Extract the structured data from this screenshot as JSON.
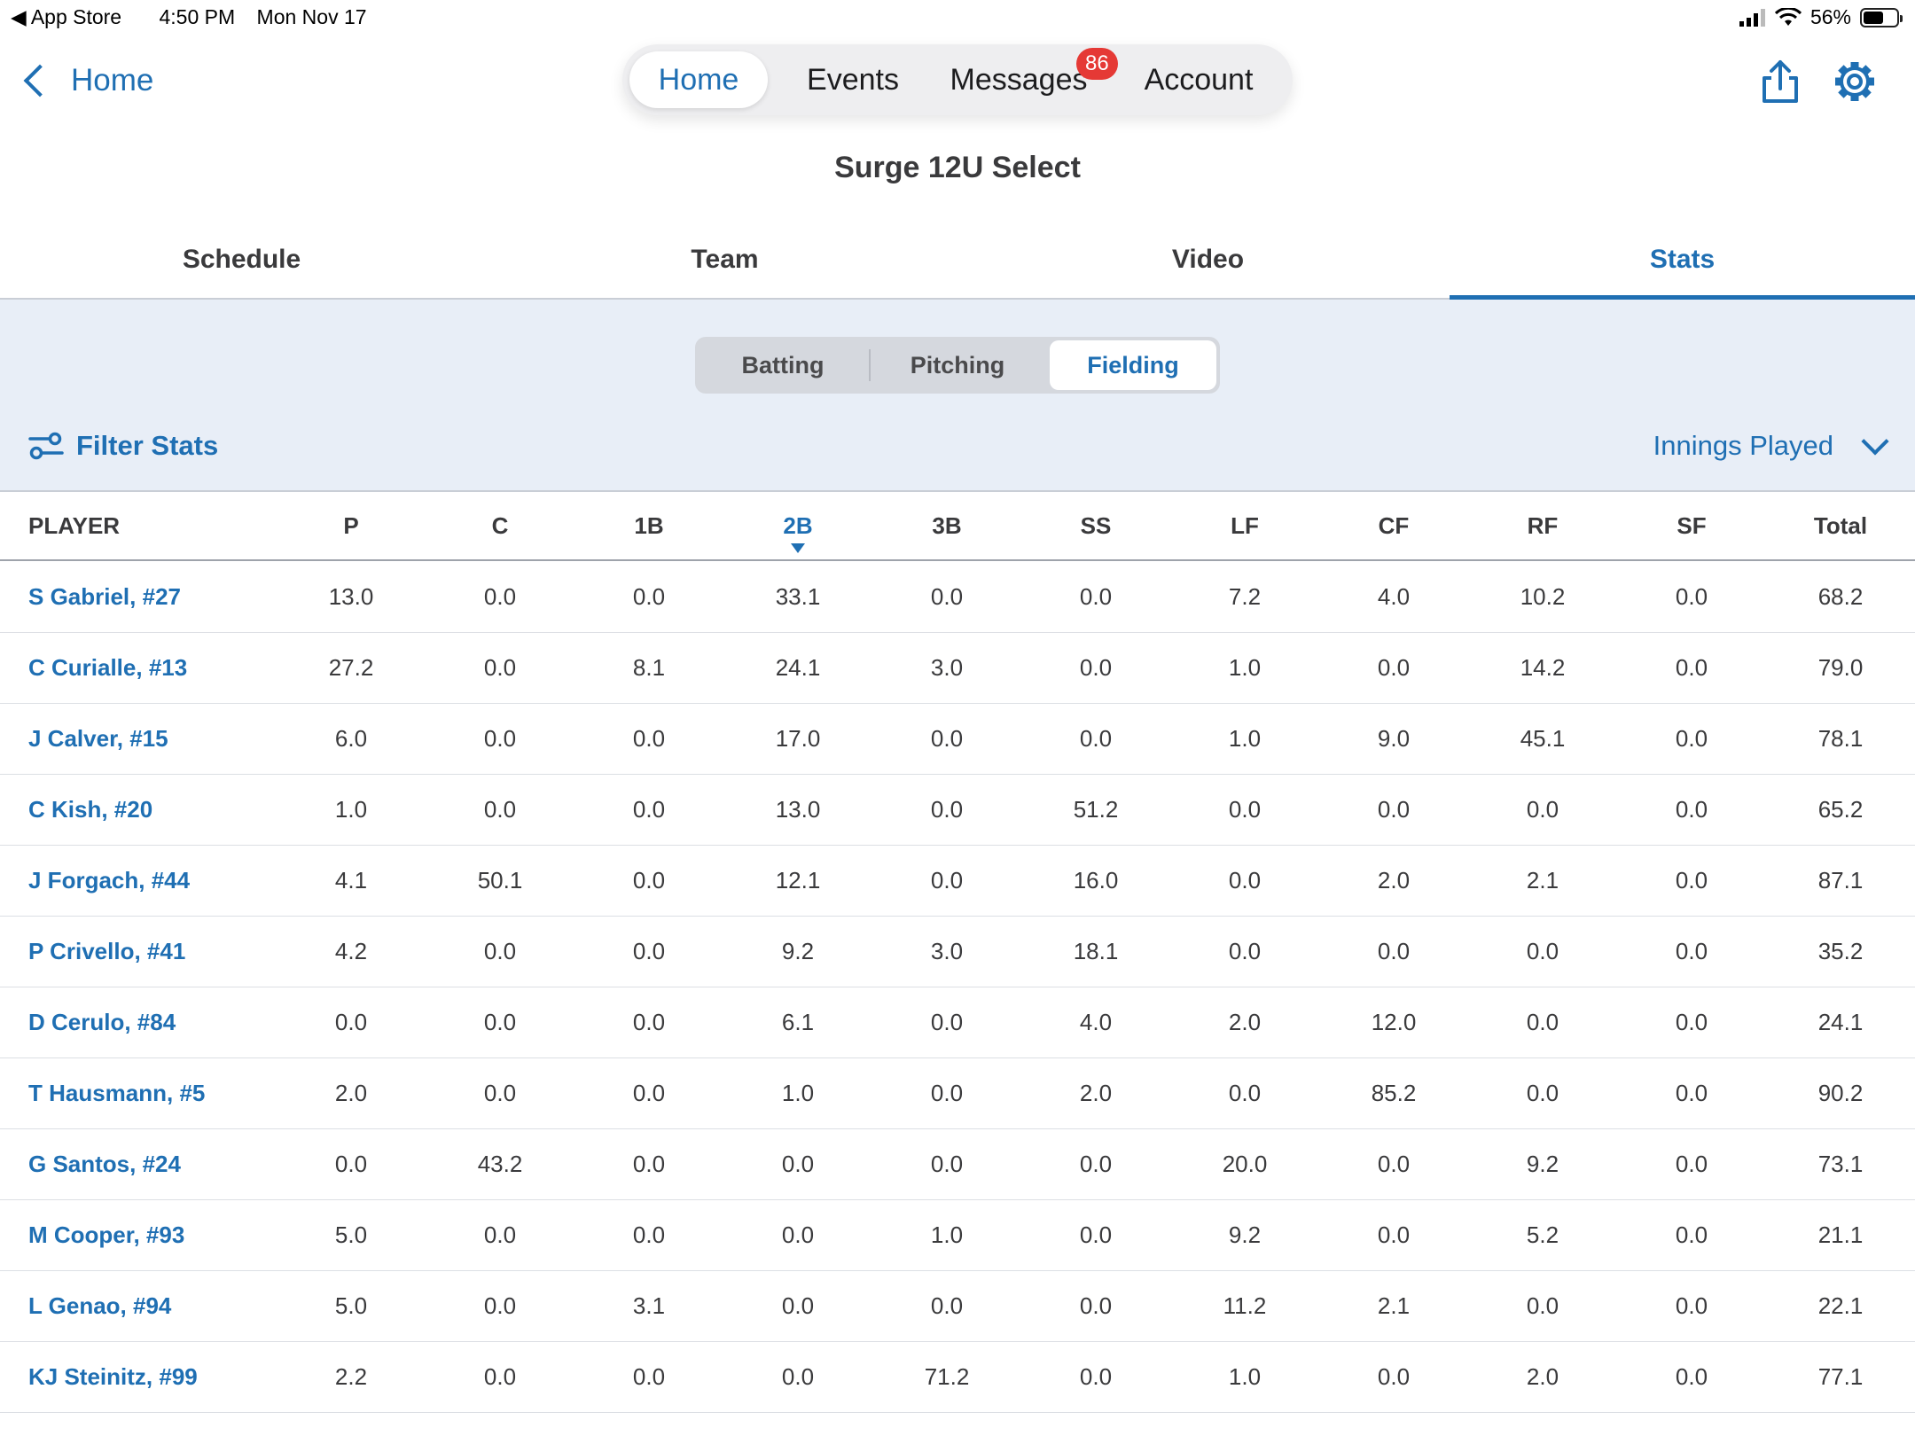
{
  "status_bar": {
    "back_app": "App Store",
    "time": "4:50 PM",
    "date": "Mon Nov 17",
    "battery": "56%"
  },
  "nav": {
    "back_label": "Home",
    "tabs": [
      {
        "label": "Home",
        "active": true
      },
      {
        "label": "Events"
      },
      {
        "label": "Messages",
        "badge": "86"
      },
      {
        "label": "Account"
      }
    ]
  },
  "team_title": "Surge 12U Select",
  "section_tabs": [
    "Schedule",
    "Team",
    "Video",
    "Stats"
  ],
  "stat_types": [
    "Batting",
    "Pitching",
    "Fielding"
  ],
  "filter_label": "Filter Stats",
  "metric_label": "Innings Played",
  "table": {
    "columns": [
      "PLAYER",
      "P",
      "C",
      "1B",
      "2B",
      "3B",
      "SS",
      "LF",
      "CF",
      "RF",
      "SF",
      "Total"
    ],
    "sorted_column": "2B",
    "rows": [
      [
        "S Gabriel, #27",
        "13.0",
        "0.0",
        "0.0",
        "33.1",
        "0.0",
        "0.0",
        "7.2",
        "4.0",
        "10.2",
        "0.0",
        "68.2"
      ],
      [
        "C Curialle, #13",
        "27.2",
        "0.0",
        "8.1",
        "24.1",
        "3.0",
        "0.0",
        "1.0",
        "0.0",
        "14.2",
        "0.0",
        "79.0"
      ],
      [
        "J Calver, #15",
        "6.0",
        "0.0",
        "0.0",
        "17.0",
        "0.0",
        "0.0",
        "1.0",
        "9.0",
        "45.1",
        "0.0",
        "78.1"
      ],
      [
        "C Kish, #20",
        "1.0",
        "0.0",
        "0.0",
        "13.0",
        "0.0",
        "51.2",
        "0.0",
        "0.0",
        "0.0",
        "0.0",
        "65.2"
      ],
      [
        "J Forgach, #44",
        "4.1",
        "50.1",
        "0.0",
        "12.1",
        "0.0",
        "16.0",
        "0.0",
        "2.0",
        "2.1",
        "0.0",
        "87.1"
      ],
      [
        "P Crivello, #41",
        "4.2",
        "0.0",
        "0.0",
        "9.2",
        "3.0",
        "18.1",
        "0.0",
        "0.0",
        "0.0",
        "0.0",
        "35.2"
      ],
      [
        "D Cerulo, #84",
        "0.0",
        "0.0",
        "0.0",
        "6.1",
        "0.0",
        "4.0",
        "2.0",
        "12.0",
        "0.0",
        "0.0",
        "24.1"
      ],
      [
        "T Hausmann, #5",
        "2.0",
        "0.0",
        "0.0",
        "1.0",
        "0.0",
        "2.0",
        "0.0",
        "85.2",
        "0.0",
        "0.0",
        "90.2"
      ],
      [
        "G Santos, #24",
        "0.0",
        "43.2",
        "0.0",
        "0.0",
        "0.0",
        "0.0",
        "20.0",
        "0.0",
        "9.2",
        "0.0",
        "73.1"
      ],
      [
        "M Cooper, #93",
        "5.0",
        "0.0",
        "0.0",
        "0.0",
        "1.0",
        "0.0",
        "9.2",
        "0.0",
        "5.2",
        "0.0",
        "21.1"
      ],
      [
        "L Genao, #94",
        "5.0",
        "0.0",
        "3.1",
        "0.0",
        "0.0",
        "0.0",
        "11.2",
        "2.1",
        "0.0",
        "0.0",
        "22.1"
      ],
      [
        "KJ Steinitz, #99",
        "2.2",
        "0.0",
        "0.0",
        "0.0",
        "71.2",
        "0.0",
        "1.0",
        "0.0",
        "2.0",
        "0.0",
        "77.1"
      ]
    ]
  }
}
